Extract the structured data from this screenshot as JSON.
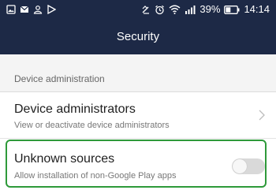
{
  "status_bar": {
    "left_icons": [
      "picture-icon",
      "mail-icon",
      "person-icon",
      "play-store-icon"
    ],
    "right_icons": [
      "nfc-icon",
      "alarm-icon",
      "wifi-icon",
      "signal-icon",
      "battery-icon"
    ],
    "battery_percent": "39%",
    "time": "14:14",
    "bg_color": "#1d2946"
  },
  "title_bar": {
    "title": "Security"
  },
  "section": {
    "header": "Device administration"
  },
  "items": [
    {
      "title": "Device administrators",
      "subtitle": "View or deactivate device administrators"
    },
    {
      "title": "Unknown sources",
      "subtitle": "Allow installation of non-Google Play apps",
      "toggle_on": false
    }
  ],
  "colors": {
    "highlight": "#2e9a3a"
  }
}
